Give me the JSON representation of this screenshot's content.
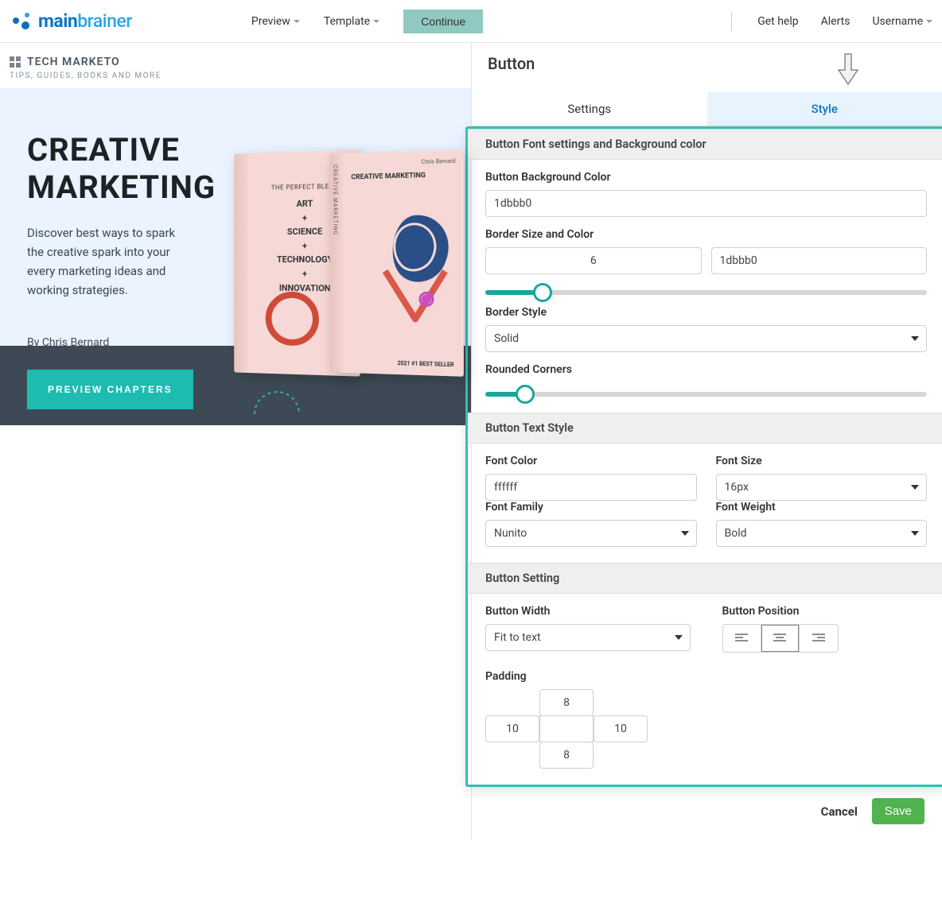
{
  "topbar": {
    "logo_main": "main",
    "logo_sub": "brainer",
    "preview": "Preview",
    "template": "Template",
    "continue": "Continue",
    "get_help": "Get help",
    "alerts": "Alerts",
    "username": "Username"
  },
  "preview": {
    "brand_name": "TECH MARKETO",
    "brand_sub": "TIPS, GUIDES, BOOKS AND MORE",
    "hero_title_1": "CREATIVE",
    "hero_title_2": "MARKETING",
    "hero_desc": "Discover best ways to spark the creative spark into your every marketing ideas and working strategies.",
    "author": "By Chris Bernard",
    "button": "PREVIEW CHAPTERS",
    "book_left_heading": "THE PERFECT BLEND",
    "book_left_lines": [
      "ART",
      "+",
      "SCIENCE",
      "+",
      "TECHNOLOGY",
      "+",
      "INNOVATION"
    ],
    "book_right_author": "Chris Bernard",
    "book_right_title": "CREATIVE MARKETING",
    "book_right_badge": "2021 #1 BEST SELLER",
    "book_spine_text": "CREATIVE MARKETING"
  },
  "panel": {
    "title": "Button",
    "tabs": {
      "settings": "Settings",
      "style": "Style"
    },
    "s1_head": "Button Font settings and Background color",
    "bg_label": "Button Background Color",
    "bg_value": "1dbbb0",
    "border_label": "Border Size and Color",
    "border_size": "6",
    "border_color": "1dbbb0",
    "border_style_label": "Border Style",
    "border_style_value": "Solid",
    "rounded_label": "Rounded Corners",
    "s2_head": "Button Text Style",
    "font_color_label": "Font Color",
    "font_color_value": "ffffff",
    "font_size_label": "Font Size",
    "font_size_value": "16px",
    "font_family_label": "Font Family",
    "font_family_value": "Nunito",
    "font_weight_label": "Font Weight",
    "font_weight_value": "Bold",
    "s3_head": "Button Setting",
    "width_label": "Button Width",
    "width_value": "Fit to text",
    "position_label": "Button Position",
    "padding_label": "Padding",
    "pad_top": "8",
    "pad_right": "10",
    "pad_bottom": "8",
    "pad_left": "10",
    "cancel": "Cancel",
    "save": "Save"
  }
}
